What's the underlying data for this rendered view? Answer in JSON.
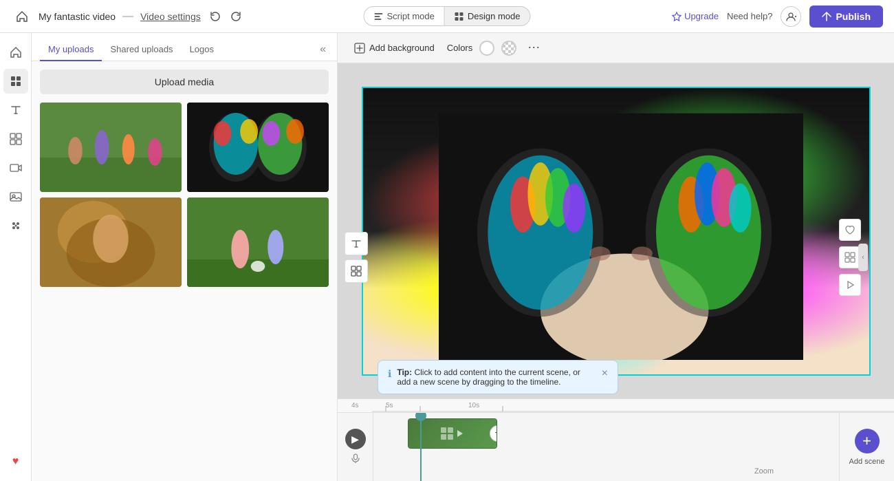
{
  "topbar": {
    "project_title": "My fantastic video",
    "separator": "—",
    "settings_label": "Video settings",
    "undo_label": "↩",
    "redo_label": "↪",
    "script_mode_label": "Script mode",
    "design_mode_label": "Design mode",
    "upgrade_label": "Upgrade",
    "help_label": "Need help?",
    "publish_label": "Publish"
  },
  "left_panel": {
    "tabs": [
      {
        "id": "my-uploads",
        "label": "My uploads"
      },
      {
        "id": "shared-uploads",
        "label": "Shared uploads"
      },
      {
        "id": "logos",
        "label": "Logos"
      }
    ],
    "active_tab": "my-uploads",
    "upload_btn_label": "Upload media",
    "collapse_tooltip": "Collapse"
  },
  "canvas": {
    "add_background_label": "Add background",
    "colors_label": "Colors"
  },
  "timeline": {
    "zoom_label": "Zoom"
  },
  "add_scene": {
    "btn_icon": "+",
    "label": "Add scene"
  },
  "tip": {
    "prefix": "Tip:",
    "text": " Click to add content into the current scene, or add a new scene by dragging to the timeline."
  },
  "sidebar_icons": {
    "home": "⌂",
    "uploads": "▲",
    "text": "T",
    "group": "⊞",
    "stock": "▶",
    "audio": "🎬",
    "photos": "🖼",
    "apps": "⬡",
    "favorite": "♥"
  },
  "ruler": {
    "marks": [
      "4s",
      "5s",
      "10s"
    ]
  }
}
